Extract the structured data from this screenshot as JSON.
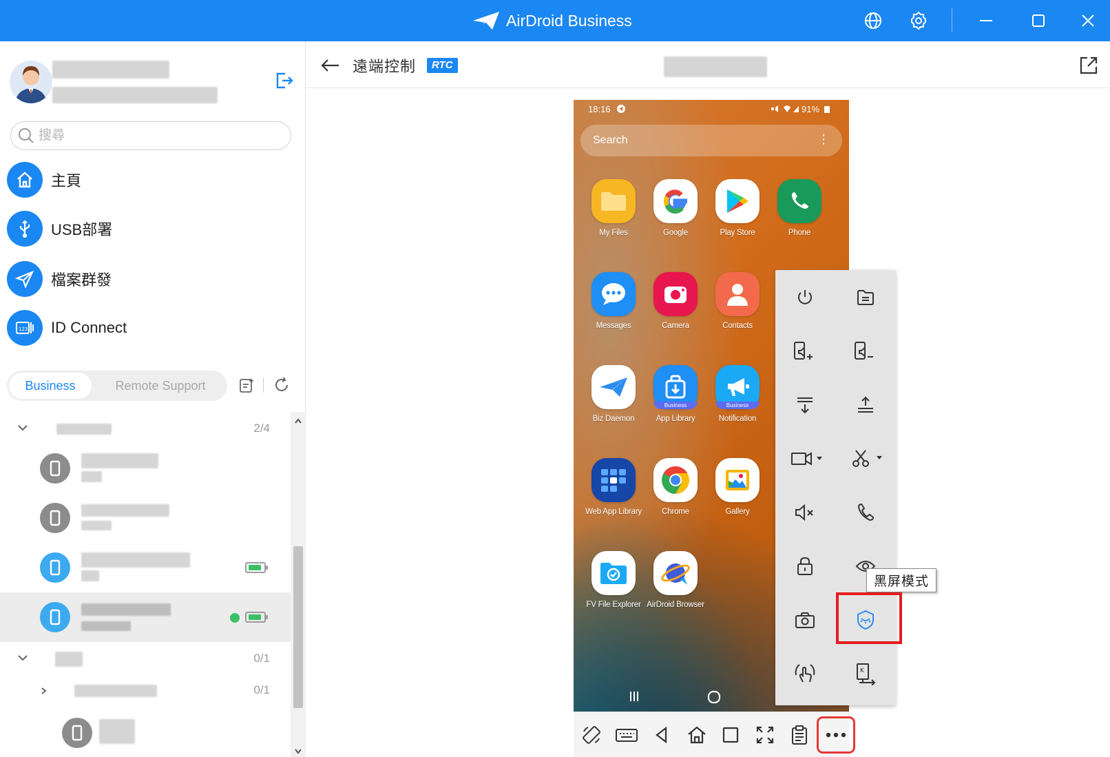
{
  "app": {
    "title": "AirDroid Business",
    "brand_color": "#1b87f2"
  },
  "sidebar": {
    "search_placeholder": "搜尋",
    "nav": [
      {
        "label": "主頁",
        "icon": "home-icon"
      },
      {
        "label": "USB部署",
        "icon": "usb-icon"
      },
      {
        "label": "檔案群發",
        "icon": "send-icon"
      },
      {
        "label": "ID Connect",
        "icon": "id-connect-icon"
      }
    ],
    "segments": {
      "business": "Business",
      "remote_support": "Remote Support",
      "active": "Business"
    },
    "groups": [
      {
        "count": "2/4"
      },
      {
        "count": "0/1"
      },
      {
        "count": "0/1"
      }
    ]
  },
  "main": {
    "page_title": "遠端控制",
    "badge": "RTC"
  },
  "phone": {
    "time": "18:16",
    "status_right": "91%",
    "search_text": "Search",
    "apps": [
      {
        "label": "My Files"
      },
      {
        "label": "Google"
      },
      {
        "label": "Play Store"
      },
      {
        "label": "Phone"
      },
      {
        "label": "Messages"
      },
      {
        "label": "Camera"
      },
      {
        "label": "Contacts"
      },
      {
        "label": "Biz Daemon"
      },
      {
        "label": "App Library"
      },
      {
        "label": "Notification"
      },
      {
        "label": "Web App Library"
      },
      {
        "label": "Chrome"
      },
      {
        "label": "Gallery"
      },
      {
        "label": "FV File Explorer"
      },
      {
        "label": "AirDroid Browser"
      }
    ],
    "app_badge": "Business"
  },
  "tool_panel": {
    "tooltip": "黑屏模式",
    "highlight_color": "#e51d1d"
  }
}
